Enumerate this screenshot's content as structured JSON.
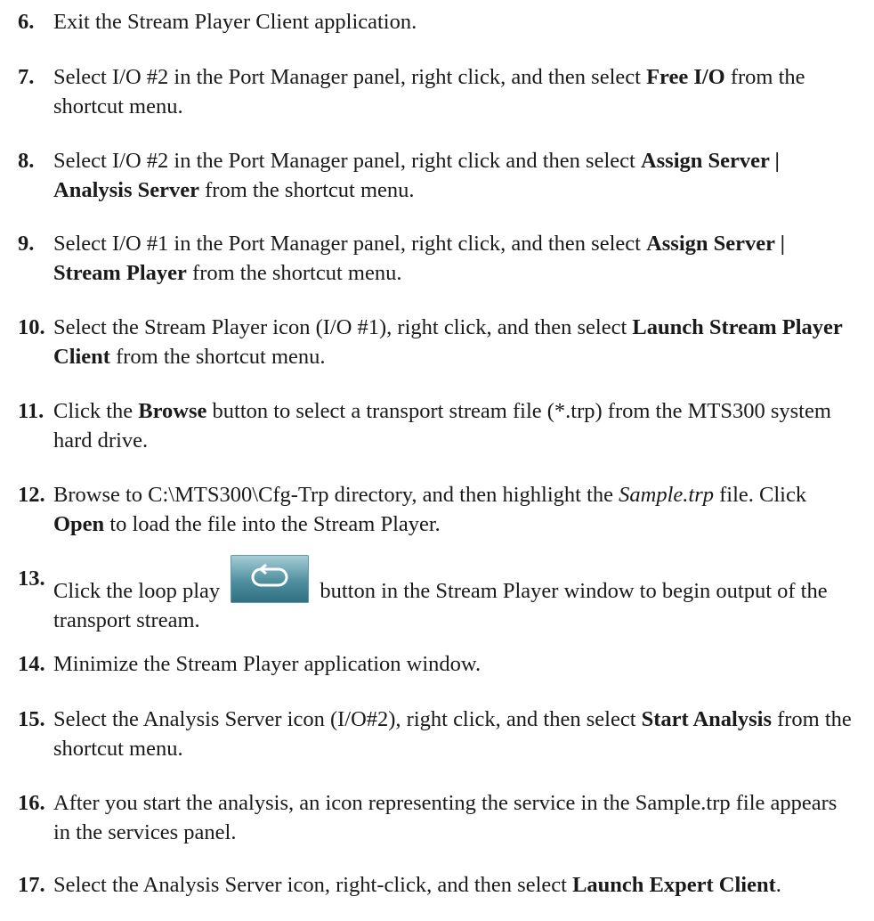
{
  "steps": [
    {
      "num": "6.",
      "parts": [
        [
          "Exit the Stream Player Client application.",
          ""
        ]
      ]
    },
    {
      "num": "7.",
      "parts": [
        [
          "Select I/O #2 in the Port Manager panel, right click, and then select ",
          ""
        ],
        [
          "Free I/O",
          "b"
        ],
        [
          " from the shortcut menu.",
          ""
        ]
      ]
    },
    {
      "num": "8.",
      "parts": [
        [
          "Select I/O #2 in the Port Manager panel, right click and then select ",
          ""
        ],
        [
          "Assign Server | Analysis Server",
          "b"
        ],
        [
          " from the shortcut menu.",
          ""
        ]
      ]
    },
    {
      "num": "9.",
      "parts": [
        [
          "Select I/O #1 in the Port Manager panel, right click, and then select ",
          ""
        ],
        [
          "Assign Server | Stream Player",
          "b"
        ],
        [
          " from the shortcut menu.",
          ""
        ]
      ]
    },
    {
      "num": "10.",
      "parts": [
        [
          "Select the Stream Player icon (I/O #1), right click, and then select ",
          ""
        ],
        [
          "Launch Stream Player Client",
          "b"
        ],
        [
          " from the shortcut menu.",
          ""
        ]
      ]
    },
    {
      "num": "11.",
      "parts": [
        [
          "Click the ",
          ""
        ],
        [
          "Browse",
          "b"
        ],
        [
          " button to select a transport stream file (*.trp) from the MTS300 system hard drive.",
          ""
        ]
      ]
    },
    {
      "num": "12.",
      "parts": [
        [
          "Browse to C:\\MTS300\\Cfg-Trp directory, and then highlight the ",
          ""
        ],
        [
          "Sample.trp",
          "i"
        ],
        [
          " file. Click ",
          ""
        ],
        [
          "Open",
          "b"
        ],
        [
          " to load the file into the Stream Player.",
          ""
        ]
      ]
    },
    {
      "num": "13.",
      "parts": [
        [
          "Click the loop play ",
          ""
        ],
        [
          "",
          "icon"
        ],
        [
          " button in the Stream Player window to begin output of the transport stream.",
          ""
        ]
      ]
    },
    {
      "num": "14.",
      "parts": [
        [
          "Minimize the Stream Player application window.",
          ""
        ]
      ]
    },
    {
      "num": "15.",
      "parts": [
        [
          "Select the Analysis Server icon (I/O#2), right click, and then select ",
          ""
        ],
        [
          "Start Analysis",
          "b"
        ],
        [
          " from the shortcut menu.",
          ""
        ]
      ]
    },
    {
      "num": "16.",
      "parts": [
        [
          "After you start the analysis, an icon representing the service in the Sample.trp file appears in the services panel.",
          ""
        ]
      ]
    },
    {
      "num": "17.",
      "parts": [
        [
          "Select the Analysis Server icon, right-click, and then select ",
          ""
        ],
        [
          "Launch Expert Client",
          "b"
        ],
        [
          ".",
          ""
        ]
      ]
    }
  ]
}
